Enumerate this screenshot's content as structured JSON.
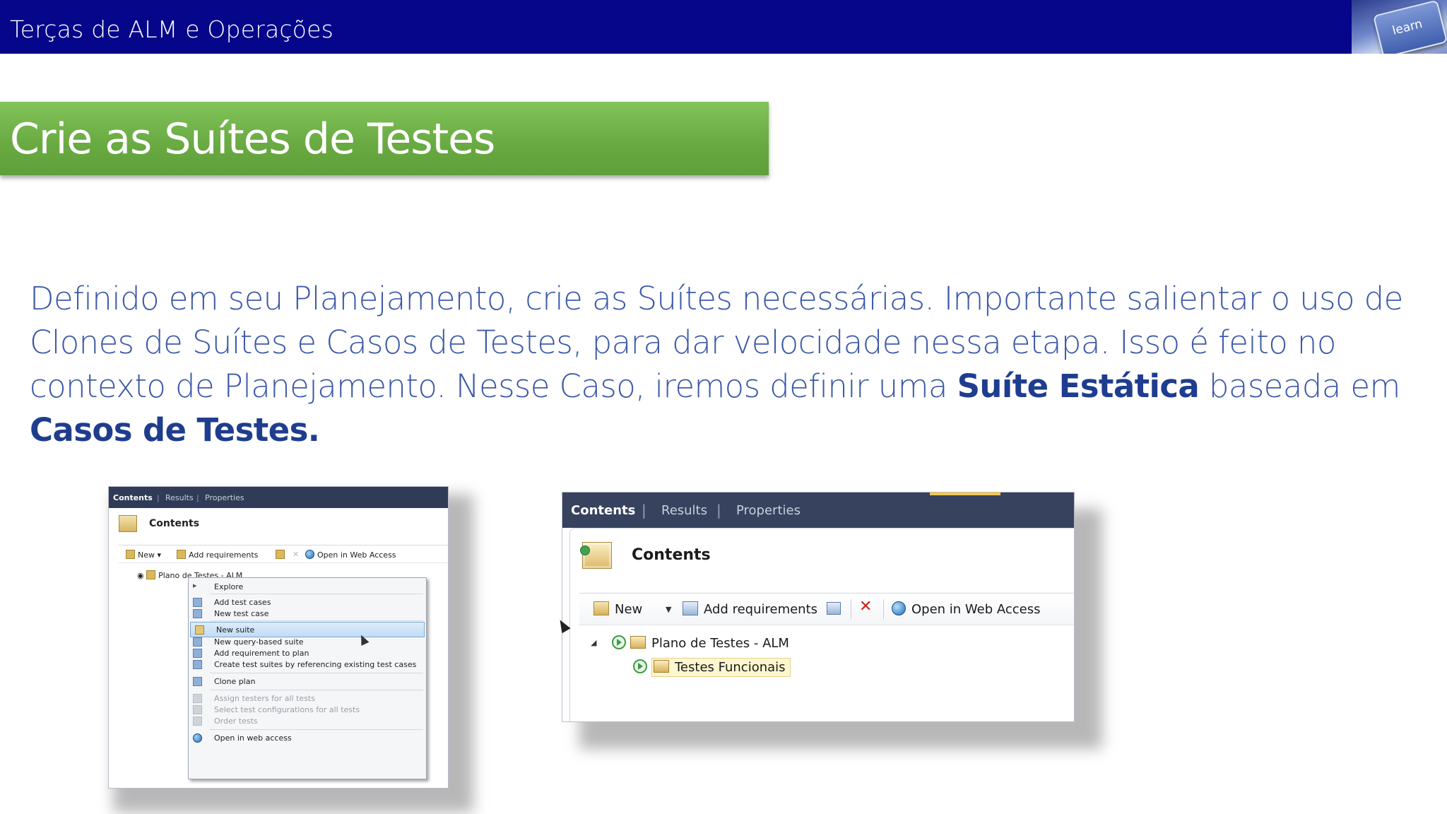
{
  "header": {
    "title": "Terças de ALM e Operações",
    "logo_key_label": "learn"
  },
  "heading": "Crie as Suítes de Testes",
  "paragraph": {
    "line1": "Definido em seu Planejamento, crie as Suítes necessárias. Importante salientar o uso de",
    "line2": "Clones de Suítes e Casos de Testes, para dar velocidade nessa etapa. Isso é feito no",
    "line3_a": "contexto de Planejamento. Nesse Caso, iremos definir uma ",
    "line3_strong": "Suíte Estática",
    "line3_b": " baseada em",
    "line4_strong": "Casos de Testes."
  },
  "shot1": {
    "tabs": [
      "Contents",
      "Results",
      "Properties"
    ],
    "title": "Contents",
    "toolbar": {
      "new": "New",
      "add_requirements": "Add requirements",
      "open_web": "Open in Web Access"
    },
    "tree_item": "Plano de Testes - ALM",
    "menu": [
      {
        "label": "Explore",
        "disabled": false
      },
      {
        "label": "Add test cases",
        "disabled": false
      },
      {
        "label": "New test case",
        "disabled": false
      },
      {
        "label": "New suite",
        "disabled": false
      },
      {
        "label": "New query-based suite",
        "disabled": false
      },
      {
        "label": "Add requirement to plan",
        "disabled": false
      },
      {
        "label": "Create test suites by referencing existing test cases",
        "disabled": false
      },
      {
        "label": "Clone plan",
        "disabled": false
      },
      {
        "label": "Assign testers for all tests",
        "disabled": true
      },
      {
        "label": "Select test configurations for all tests",
        "disabled": true
      },
      {
        "label": "Order tests",
        "disabled": true
      },
      {
        "label": "Open in web access",
        "disabled": false
      }
    ]
  },
  "shot2": {
    "tabs": [
      "Contents",
      "Results",
      "Properties"
    ],
    "title": "Contents",
    "toolbar": {
      "new": "New",
      "add_requirements": "Add requirements",
      "open_web": "Open in Web Access"
    },
    "tree": {
      "root": "Plano de Testes - ALM",
      "child": "Testes Funcionais"
    }
  }
}
